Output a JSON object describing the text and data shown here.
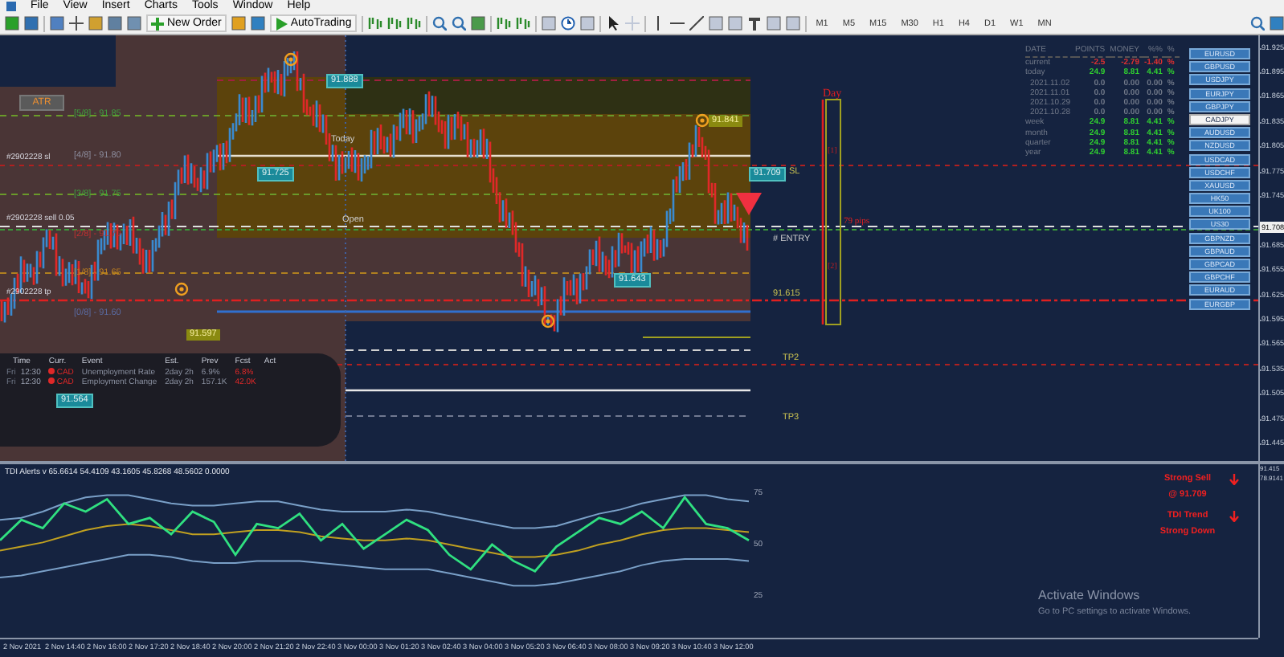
{
  "menu": [
    "File",
    "View",
    "Insert",
    "Charts",
    "Tools",
    "Window",
    "Help"
  ],
  "toolbar": {
    "new_order": "New Order",
    "autotrading": "AutoTrading",
    "timeframes": [
      "M1",
      "M5",
      "M15",
      "M30",
      "H1",
      "H4",
      "D1",
      "W1",
      "MN"
    ]
  },
  "chart": {
    "atr_button": "ATR",
    "murrey_levels": [
      {
        "label": "[5/8] - 91.85",
        "color": "#3f9f3f"
      },
      {
        "label": "[4/8] - 91.80",
        "color": "#8a8a9a"
      },
      {
        "label": "[3/8] - 91.75",
        "color": "#3f9f3f"
      },
      {
        "label": "[2/8] - 91.70",
        "color": "#c03030"
      },
      {
        "label": "[1/8] - 91.65",
        "color": "#c08020"
      },
      {
        "label": "[0/8] - 91.60",
        "color": "#5a6aa0"
      }
    ],
    "trade_lines": [
      "#2902228 sl",
      "#2902228 sell 0.05",
      "#2902228 tp"
    ],
    "labels": [
      {
        "text": "91.888",
        "kind": "teal"
      },
      {
        "text": "91.725",
        "kind": "teal"
      },
      {
        "text": "91.643",
        "kind": "teal"
      },
      {
        "text": "91.597",
        "kind": "olive"
      },
      {
        "text": "91.841",
        "kind": "olive"
      },
      {
        "text": "91.709",
        "kind": "teal"
      },
      {
        "text": "SL",
        "kind": "line"
      },
      {
        "text": "# ENTRY",
        "kind": "note"
      },
      {
        "text": "91.615",
        "kind": "line"
      },
      {
        "text": "TP2",
        "kind": "line"
      },
      {
        "text": "TP3",
        "kind": "line"
      },
      {
        "text": "Today",
        "kind": "note"
      },
      {
        "text": "Open",
        "kind": "note"
      },
      {
        "text": "91.564",
        "kind": "teal"
      }
    ],
    "day_box": {
      "title": "Day",
      "upper": "[1]",
      "pips": "79 pips",
      "lower": "[2]"
    }
  },
  "stats": {
    "columns": [
      "DATE",
      "POINTS",
      "MONEY",
      "%%",
      "%"
    ],
    "rows": [
      {
        "date": "current",
        "points": "-2.5",
        "money": "-2.79",
        "percent": "-1.40",
        "unit": "%",
        "color": "#e03030"
      },
      {
        "date": "today",
        "points": "24.9",
        "money": "8.81",
        "percent": "4.41",
        "unit": "%",
        "color": "#30d030"
      },
      {
        "date": "2021.11.02",
        "points": "0.0",
        "money": "0.00",
        "percent": "0.00",
        "unit": "%",
        "color": "#707888"
      },
      {
        "date": "2021.11.01",
        "points": "0.0",
        "money": "0.00",
        "percent": "0.00",
        "unit": "%",
        "color": "#707888"
      },
      {
        "date": "2021.10.29",
        "points": "0.0",
        "money": "0.00",
        "percent": "0.00",
        "unit": "%",
        "color": "#707888"
      },
      {
        "date": "2021.10.28",
        "points": "0.0",
        "money": "0.00",
        "percent": "0.00",
        "unit": "%",
        "color": "#707888"
      },
      {
        "date": "week",
        "points": "24.9",
        "money": "8.81",
        "percent": "4.41",
        "unit": "%",
        "color": "#30d030"
      },
      {
        "date": "month",
        "points": "24.9",
        "money": "8.81",
        "percent": "4.41",
        "unit": "%",
        "color": "#30d030"
      },
      {
        "date": "quarter",
        "points": "24.9",
        "money": "8.81",
        "percent": "4.41",
        "unit": "%",
        "color": "#30d030"
      },
      {
        "date": "year",
        "points": "24.9",
        "money": "8.81",
        "percent": "4.41",
        "unit": "%",
        "color": "#30d030"
      }
    ]
  },
  "symbols": [
    {
      "label": "EURUSD",
      "selected": false
    },
    {
      "label": "GBPUSD",
      "selected": false
    },
    {
      "label": "USDJPY",
      "selected": false
    },
    {
      "label": "EURJPY",
      "selected": false
    },
    {
      "label": "GBPJPY",
      "selected": false
    },
    {
      "label": "CADJPY",
      "selected": true
    },
    {
      "label": "AUDUSD",
      "selected": false
    },
    {
      "label": "NZDUSD",
      "selected": false
    },
    {
      "label": "USDCAD",
      "selected": false
    },
    {
      "label": "USDCHF",
      "selected": false
    },
    {
      "label": "XAUUSD",
      "selected": false
    },
    {
      "label": "HK50",
      "selected": false
    },
    {
      "label": "UK100",
      "selected": false
    },
    {
      "label": "US30",
      "selected": false
    },
    {
      "label": "GBPNZD",
      "selected": false
    },
    {
      "label": "GBPAUD",
      "selected": false
    },
    {
      "label": "GBPCAD",
      "selected": false
    },
    {
      "label": "GBPCHF",
      "selected": false
    },
    {
      "label": "EURAUD",
      "selected": false
    },
    {
      "label": "EURGBP",
      "selected": false
    }
  ],
  "calendar": {
    "columns": [
      "Time",
      "Curr.",
      "Event",
      "Est.",
      "Prev",
      "Fcst",
      "Act"
    ],
    "rows": [
      {
        "day": "Fri",
        "time": "12:30",
        "currency": "CAD",
        "event": "Unemployment Rate",
        "est": "2day 2h",
        "prev": "6.9%",
        "fcst": "6.8%",
        "color": "#e02828"
      },
      {
        "day": "Fri",
        "time": "12:30",
        "currency": "CAD",
        "event": "Employment Change",
        "est": "2day 2h",
        "prev": "157.1K",
        "fcst": "42.0K",
        "color": "#e02828"
      }
    ]
  },
  "price_axis": [
    "91.925",
    "91.895",
    "91.865",
    "91.835",
    "91.805",
    "91.775",
    "91.745",
    "91.685",
    "91.655",
    "91.625",
    "91.595",
    "91.565",
    "91.535",
    "91.505",
    "91.475",
    "91.445"
  ],
  "current_price": "91.708",
  "indicator": {
    "title": "TDI Alerts v 65.6614 54.4109 43.1605 45.8268 48.5602 0.0000",
    "axis": [
      "91.415",
      "78.9141"
    ],
    "chart_data": {
      "type": "line",
      "ylim": [
        25,
        75
      ],
      "yticks": [
        25,
        50,
        75
      ],
      "series": [
        {
          "color": "#30e080",
          "values": [
            52,
            62,
            58,
            70,
            66,
            72,
            60,
            63,
            55,
            66,
            61,
            45,
            60,
            58,
            65,
            52,
            60,
            48,
            55,
            62,
            57,
            45,
            38,
            50,
            42,
            37,
            49,
            56,
            63,
            60,
            66,
            58,
            73,
            60,
            58,
            52
          ]
        },
        {
          "color": "#c0a020",
          "values": [
            47,
            49,
            51,
            54,
            57,
            59,
            60,
            59,
            57,
            55,
            55,
            56,
            57,
            57,
            56,
            54,
            53,
            52,
            52,
            53,
            52,
            50,
            48,
            46,
            44,
            44,
            45,
            47,
            50,
            52,
            55,
            57,
            58,
            58,
            57,
            56
          ]
        },
        {
          "color": "#7aa0c8",
          "values": [
            62,
            63,
            66,
            70,
            73,
            74,
            74,
            72,
            70,
            69,
            69,
            70,
            71,
            71,
            69,
            67,
            66,
            66,
            66,
            67,
            66,
            64,
            62,
            60,
            58,
            58,
            59,
            62,
            65,
            67,
            70,
            72,
            74,
            74,
            72,
            71
          ]
        },
        {
          "color": "#7aa0c8",
          "values": [
            34,
            35,
            37,
            39,
            41,
            43,
            45,
            45,
            44,
            42,
            41,
            41,
            42,
            42,
            42,
            41,
            40,
            39,
            38,
            38,
            38,
            36,
            34,
            32,
            30,
            30,
            31,
            33,
            35,
            37,
            40,
            42,
            43,
            43,
            43,
            42
          ]
        }
      ]
    },
    "alerts": [
      {
        "lines": [
          "Strong Sell",
          "@ 91.709"
        ]
      },
      {
        "lines": [
          "TDI Trend",
          "Strong Down"
        ]
      }
    ]
  },
  "time_axis": [
    "2 Nov 2021",
    "2 Nov 14:40",
    "2 Nov 16:00",
    "2 Nov 17:20",
    "2 Nov 18:40",
    "2 Nov 20:00",
    "2 Nov 21:20",
    "2 Nov 22:40",
    "3 Nov 00:00",
    "3 Nov 01:20",
    "3 Nov 02:40",
    "3 Nov 04:00",
    "3 Nov 05:20",
    "3 Nov 06:40",
    "3 Nov 08:00",
    "3 Nov 09:20",
    "3 Nov 10:40",
    "3 Nov 12:00"
  ],
  "os_notice": {
    "title": "Activate Windows",
    "text": "Go to PC settings to activate Windows."
  }
}
